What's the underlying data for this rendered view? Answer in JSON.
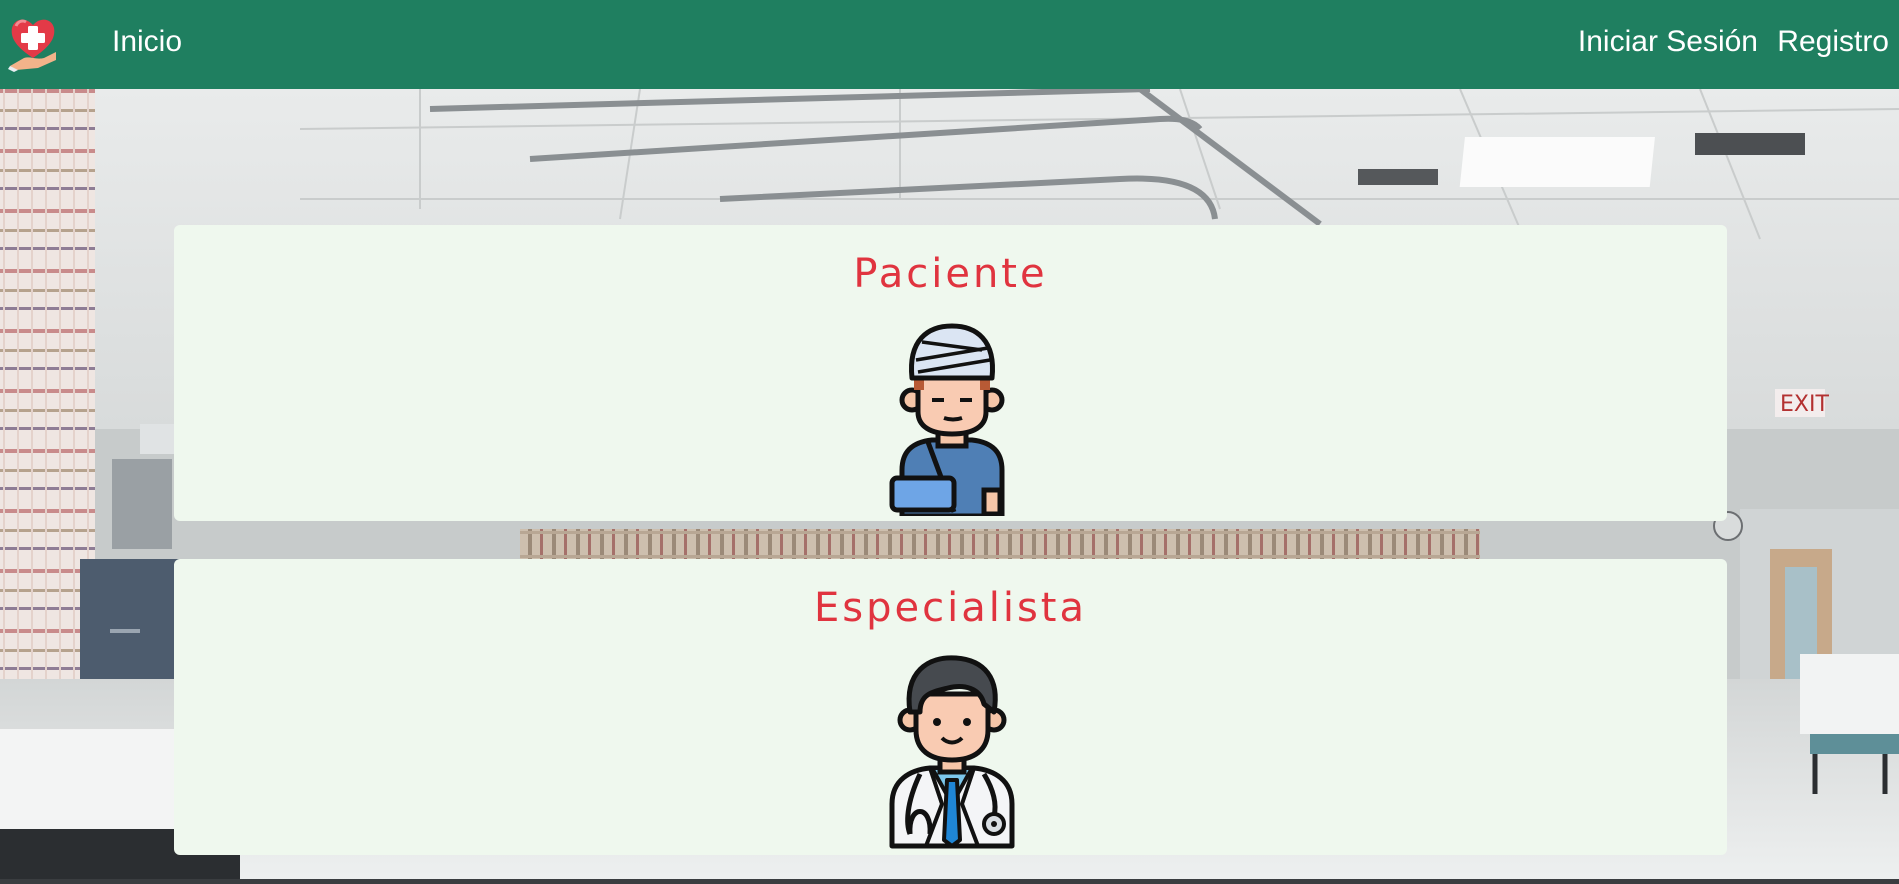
{
  "navbar": {
    "logo_icon": "heart-medical-cross-hand-icon",
    "home_label": "Inicio",
    "login_label": "Iniciar Sesión",
    "register_label": "Registro",
    "background_color": "#1f7f60"
  },
  "background": {
    "scene": "hospital-ward-photo",
    "exit_sign_text": "EXIT"
  },
  "cards": [
    {
      "title": "Paciente",
      "icon": "patient-bandaged-icon"
    },
    {
      "title": "Especialista",
      "icon": "doctor-stethoscope-icon"
    }
  ],
  "colors": {
    "accent": "#e0343f",
    "card_background": "#eff8ee",
    "nav_background": "#1f7f60"
  }
}
